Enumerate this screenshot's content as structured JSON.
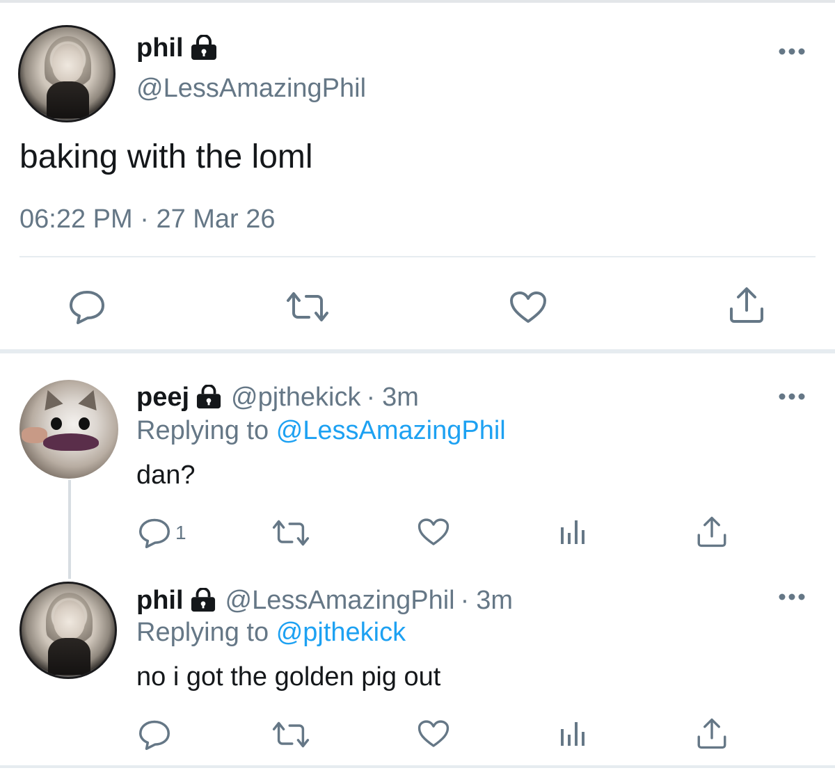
{
  "main_tweet": {
    "display_name": "phil",
    "handle": "@LessAmazingPhil",
    "text": "baking with the loml",
    "time": "06:22 PM",
    "date": "27 Mar 26",
    "meta_sep": "·"
  },
  "replies": [
    {
      "display_name": "peej",
      "handle": "@pjthekick",
      "age": "3m",
      "sep": "·",
      "replying_prefix": "Replying to",
      "replying_to": "@LessAmazingPhil",
      "text": "dan?",
      "reply_count": "1"
    },
    {
      "display_name": "phil",
      "handle": "@LessAmazingPhil",
      "age": "3m",
      "sep": "·",
      "replying_prefix": "Replying to",
      "replying_to": "@pjthekick",
      "text": "no i got the golden pig out"
    }
  ],
  "icons": {
    "reply": "reply-icon",
    "retweet": "retweet-icon",
    "like": "heart-icon",
    "share": "share-icon",
    "analytics": "analytics-icon",
    "more": "more-icon",
    "lock": "lock-icon"
  },
  "colors": {
    "text": "#14171a",
    "secondary": "#657786",
    "link": "#1da1f2",
    "divider": "#e6ecf0"
  }
}
